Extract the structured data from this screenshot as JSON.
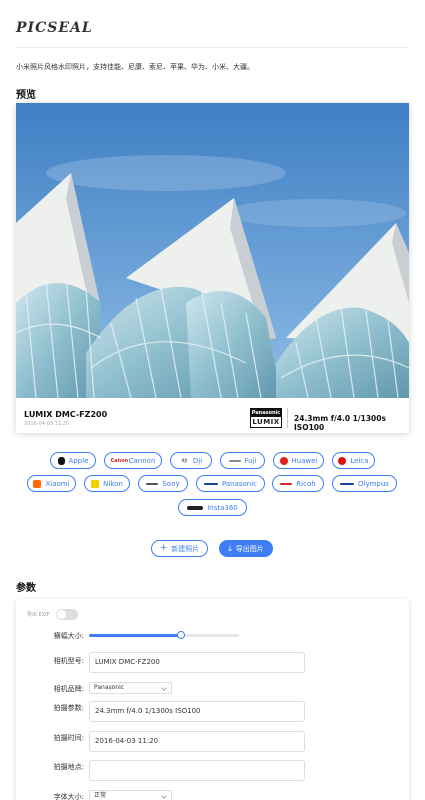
{
  "header": {
    "logo": "PICSEAL",
    "description": "小米照片风格水印照片，支持佳能、尼康、索尼、苹果、华为、小米、大疆。"
  },
  "sections": {
    "preview": "预览",
    "params": "参数"
  },
  "watermark": {
    "model": "LUMIX DMC-FZ200",
    "date": "2016-04-03 11:20",
    "logo_top": "Panasonic",
    "logo_bottom": "LUMIX",
    "params": "24.3mm f/4.0 1/1300s ISO100"
  },
  "brands": [
    {
      "label": "Apple",
      "icon": "apple-icon"
    },
    {
      "label": "Cannon",
      "icon": "canon-icon"
    },
    {
      "label": "Dji",
      "icon": "dji-icon"
    },
    {
      "label": "Fuji",
      "icon": "fuji-icon"
    },
    {
      "label": "Huawei",
      "icon": "huawei-icon"
    },
    {
      "label": "Leica",
      "icon": "leica-icon"
    },
    {
      "label": "Xiaomi",
      "icon": "xiaomi-icon"
    },
    {
      "label": "Nikon",
      "icon": "nikon-icon"
    },
    {
      "label": "Sony",
      "icon": "sony-icon"
    },
    {
      "label": "Panasonic",
      "icon": "panasonic-icon"
    },
    {
      "label": "Ricoh",
      "icon": "ricoh-icon"
    },
    {
      "label": "Olympus",
      "icon": "olympus-icon"
    },
    {
      "label": "Insta360",
      "icon": "insta360-icon"
    }
  ],
  "buttons": {
    "new": "新建照片",
    "export": "导出图片"
  },
  "form": {
    "exif_label": "导出 EXIF",
    "exif_enabled": false,
    "border_label": "横幅大小:",
    "border_value_fraction": 0.61,
    "model_label": "相机型号:",
    "model_value": "LUMIX DMC-FZ200",
    "brand_label": "相机品牌:",
    "brand_value": "Panasonic",
    "params_label": "拍摄参数:",
    "params_value": "24.3mm f/4.0 1/1300s ISO100",
    "time_label": "拍摄时间:",
    "time_value": "2016-04-03 11:20",
    "location_label": "拍摄地点:",
    "location_value": "",
    "font_label": "字体大小:",
    "font_value": "正常"
  },
  "colors": {
    "accent": "#3f7df5",
    "sky": "#5b95cf",
    "roof": "#eef0ee",
    "glass": "#9fc7d4"
  }
}
